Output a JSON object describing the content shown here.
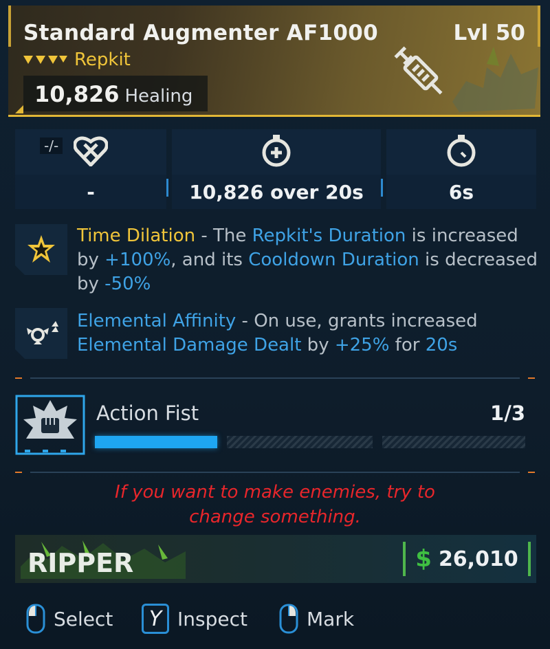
{
  "item": {
    "name": "Standard Augmenter AF1000",
    "level": "Lvl 50",
    "type": "Repkit",
    "primary_stat_value": "10,826",
    "primary_stat_label": "Healing",
    "rarity_color": "#f0c53a"
  },
  "stats": [
    {
      "icon": "heart-slash-icon",
      "tag": "-/-",
      "value": "-"
    },
    {
      "icon": "stopwatch-heal-icon",
      "value": "10,826 over 20s"
    },
    {
      "icon": "cooldown-timer-icon",
      "value": "6s"
    }
  ],
  "perks": [
    {
      "icon": "star-burst-icon",
      "name": "Time Dilation",
      "parts": [
        " - The ",
        "Repkit's Duration",
        " is increased by ",
        "+100%",
        ", and its ",
        "Cooldown Duration",
        " is decreased by ",
        "-50%"
      ]
    },
    {
      "icon": "elemental-arrows-icon",
      "name": "Elemental Affinity",
      "parts": [
        " - On use, grants increased ",
        "Elemental Damage Dealt",
        " by ",
        "+25%",
        " for ",
        "20s"
      ]
    }
  ],
  "mod": {
    "icon": "fist-burst-icon",
    "name": "Action Fist",
    "count": "1/3",
    "progress_filled_segments": 1,
    "progress_total_segments": 3
  },
  "quote": {
    "line1": "If you want to make enemies, try to",
    "line2": "change something."
  },
  "manufacturer": {
    "name": "RIPPER",
    "logo_icon": "ripper-logo"
  },
  "price": {
    "currency_symbol": "$",
    "value": "26,010",
    "color": "#3fbf42"
  },
  "controls": [
    {
      "icon": "mouse-left-icon",
      "label": "Select"
    },
    {
      "icon": "y-button-icon",
      "key": "Y",
      "label": "Inspect"
    },
    {
      "icon": "mouse-right-icon",
      "label": "Mark"
    }
  ]
}
